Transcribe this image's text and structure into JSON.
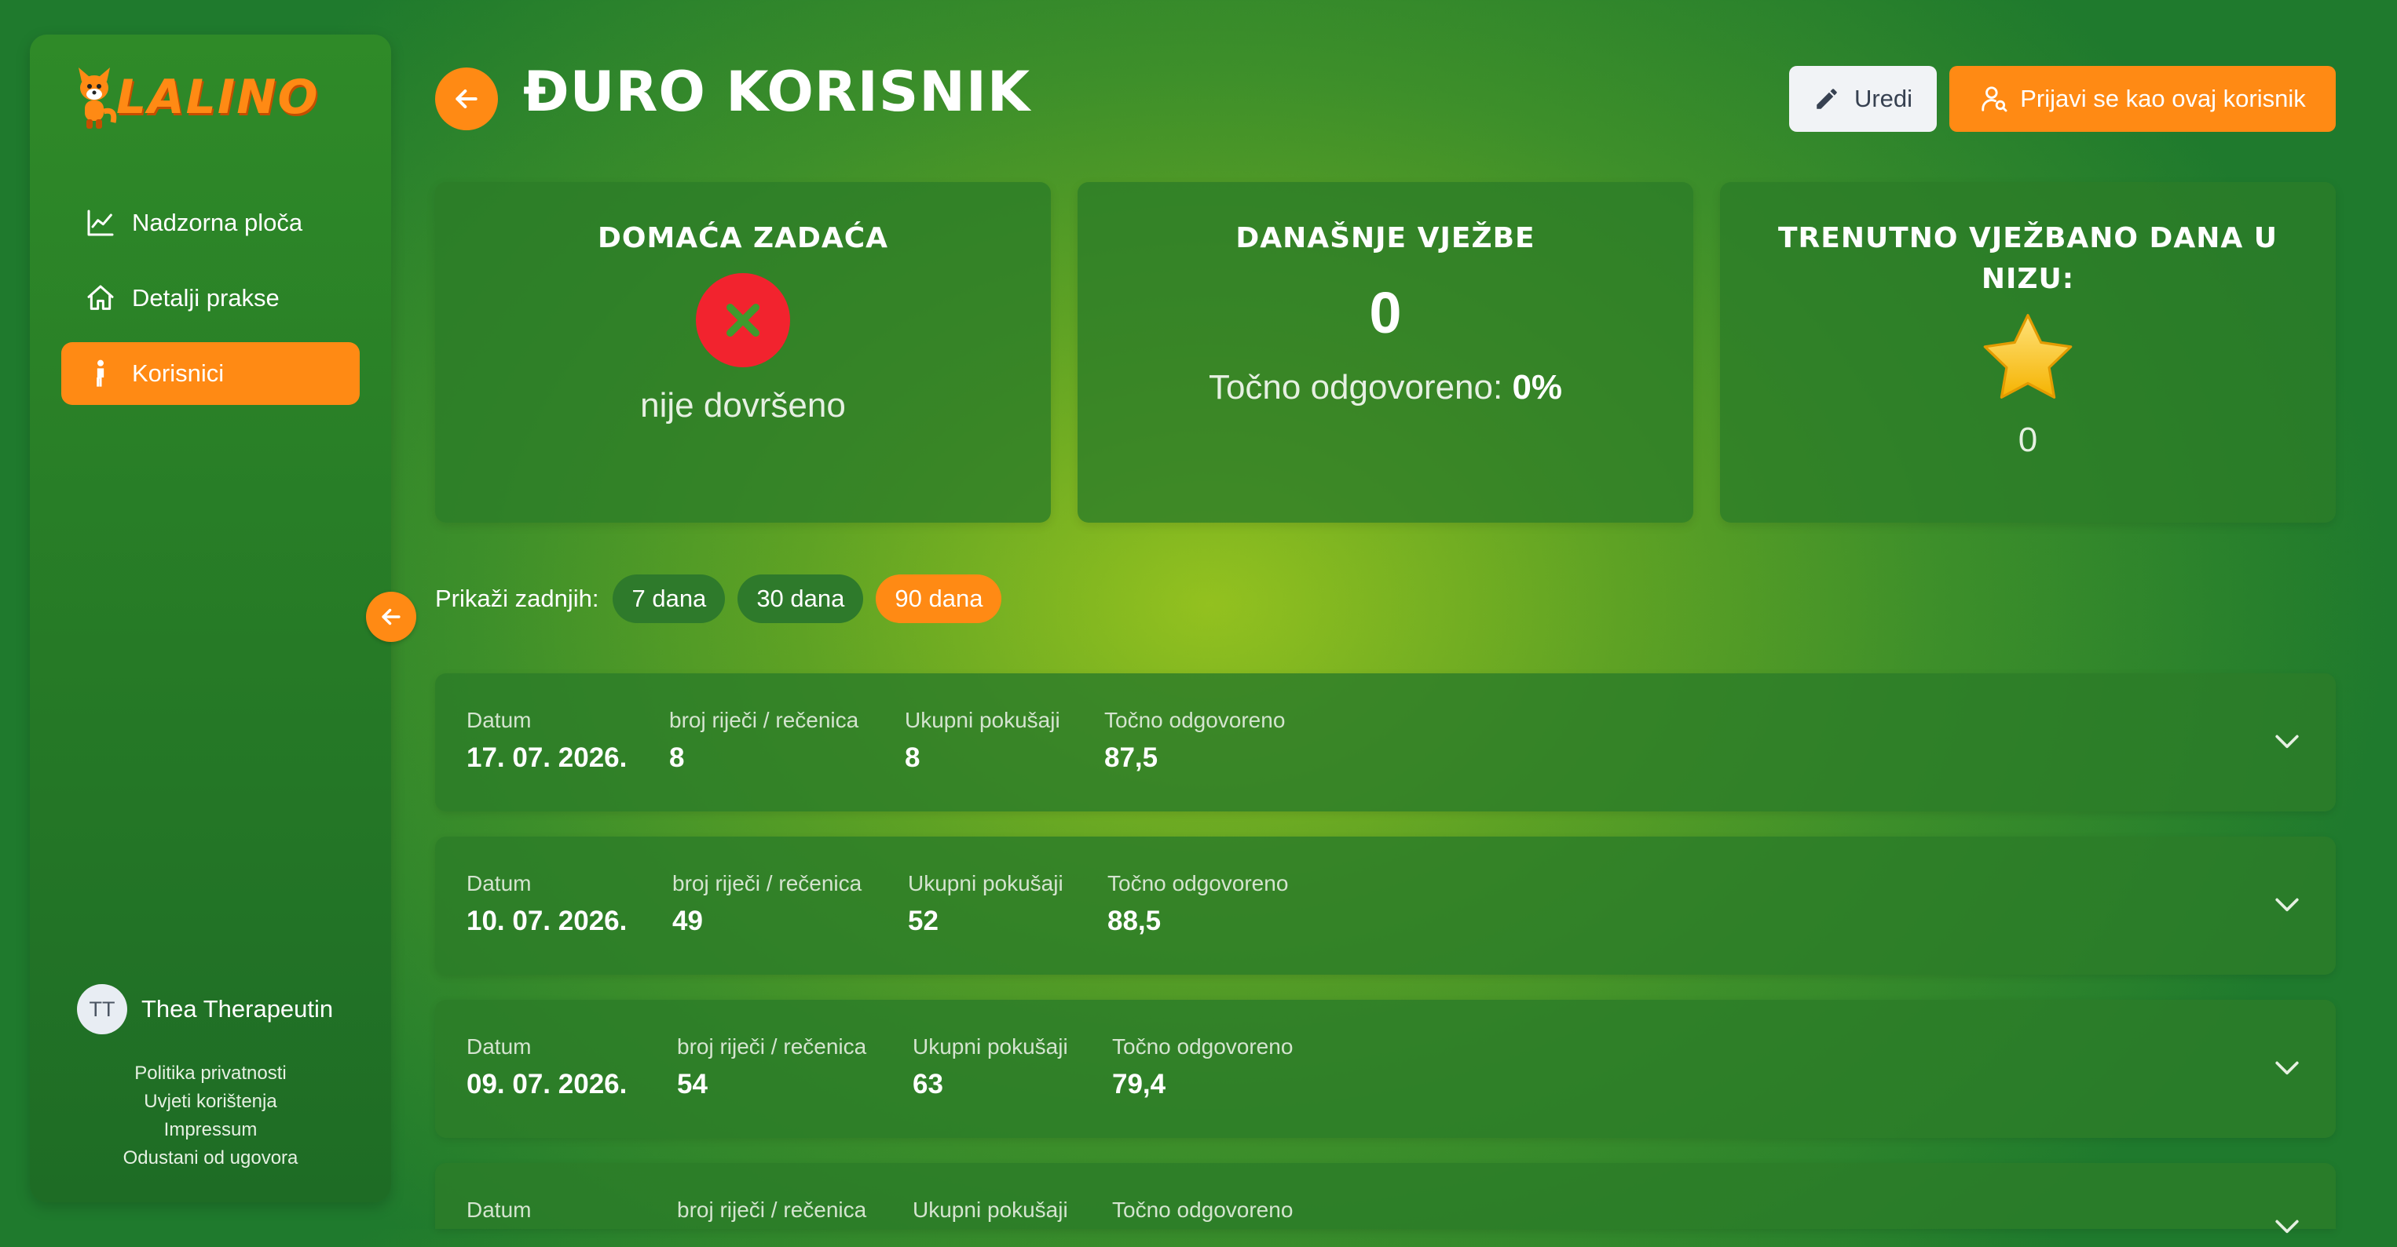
{
  "brand": {
    "name": "LALINO"
  },
  "sidebar": {
    "items": [
      {
        "label": "Nadzorna ploča",
        "icon": "chart-line-icon"
      },
      {
        "label": "Detalji prakse",
        "icon": "home-icon"
      },
      {
        "label": "Korisnici",
        "icon": "person-icon",
        "active": true
      }
    ],
    "user": {
      "initials": "TT",
      "name": "Thea Therapeutin"
    },
    "footer_links": [
      "Politika privatnosti",
      "Uvjeti korištenja",
      "Impressum",
      "Odustani od ugovora"
    ]
  },
  "header": {
    "title": "ĐURO KORISNIK",
    "edit_label": "Uredi",
    "login_as_label": "Prijavi se kao ovaj korisnik"
  },
  "cards": {
    "homework": {
      "title": "DOMAĆA ZADAĆA",
      "status": "nije dovršeno"
    },
    "today": {
      "title": "DANAŠNJE VJEŽBE",
      "count": "0",
      "accuracy_label": "Točno odgovoreno:",
      "accuracy_value": "0%"
    },
    "streak": {
      "title": "TRENUTNO VJEŽBANO DANA U NIZU:",
      "value": "0"
    }
  },
  "filter": {
    "label": "Prikaži zadnjih:",
    "options": [
      "7 dana",
      "30 dana",
      "90 dana"
    ],
    "selected": "90 dana"
  },
  "table": {
    "headers": {
      "date": "Datum",
      "words": "broj riječi / rečenica",
      "attempts": "Ukupni pokušaji",
      "correct": "Točno odgovoreno"
    },
    "rows": [
      {
        "date": "17. 07. 2026.",
        "words": "8",
        "attempts": "8",
        "correct": "87,5"
      },
      {
        "date": "10. 07. 2026.",
        "words": "49",
        "attempts": "52",
        "correct": "88,5"
      },
      {
        "date": "09. 07. 2026.",
        "words": "54",
        "attempts": "63",
        "correct": "79,4"
      },
      {
        "date": "",
        "words": "",
        "attempts": "",
        "correct": ""
      }
    ]
  },
  "colors": {
    "accent": "#ff8a14",
    "error": "#f2232e",
    "card": "#2c7c28"
  }
}
